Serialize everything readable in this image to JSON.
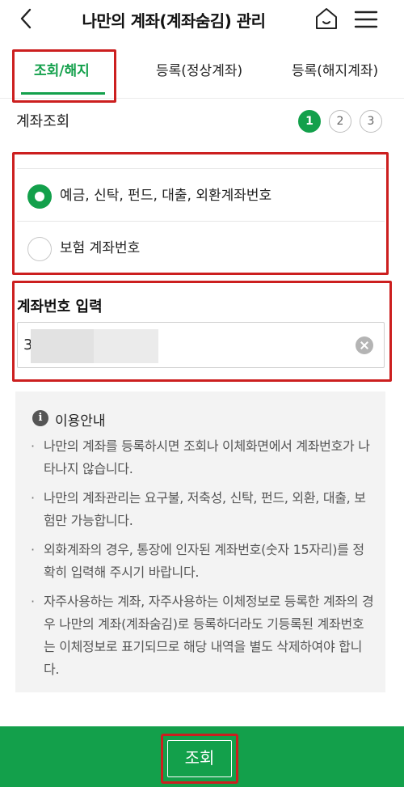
{
  "header": {
    "title": "나만의 계좌(계좌숨김) 관리",
    "back_icon": "chevron-left-icon",
    "home_icon": "home-icon",
    "menu_icon": "hamburger-menu-icon"
  },
  "tabs": [
    {
      "label": "조회/해지",
      "active": true
    },
    {
      "label": "등록(정상계좌)",
      "active": false
    },
    {
      "label": "등록(해지계좌)",
      "active": false
    }
  ],
  "section": {
    "title": "계좌조회",
    "steps": [
      "1",
      "2",
      "3"
    ],
    "current_step": "1"
  },
  "account_type": {
    "options": [
      {
        "label": "예금, 신탁, 펀드, 대출, 외환계좌번호",
        "checked": true
      },
      {
        "label": "보험 계좌번호",
        "checked": false
      }
    ]
  },
  "account_input": {
    "label": "계좌번호 입력",
    "value": "3"
  },
  "notice": {
    "title": "이용안내",
    "items": [
      {
        "bullet": "·",
        "text": "나만의 계좌를 등록하시면 조회나 이체화면에서 계좌번호가 나타나지 않습니다."
      },
      {
        "bullet": "·",
        "text": "나만의 계좌관리는 요구불, 저축성, 신탁, 펀드, 외환, 대출, 보험만 가능합니다."
      },
      {
        "bullet": "·",
        "text": "외화계좌의 경우, 통장에 인자된 계좌번호(숫자 15자리)를 정확히 입력해 주시기 바랍니다."
      },
      {
        "bullet": "·",
        "text": "자주사용하는 계좌, 자주사용하는 이체정보로 등록한 계좌의 경우 나만의 계좌(계좌숨김)로 등록하더라도 기등록된 계좌번호는 이체정보로 표기되므로 해당 내역을 별도 삭제하여야 합니다."
      }
    ]
  },
  "footer": {
    "submit_label": "조회"
  },
  "colors": {
    "accent": "#13a04b",
    "highlight": "#cc1f1f"
  }
}
